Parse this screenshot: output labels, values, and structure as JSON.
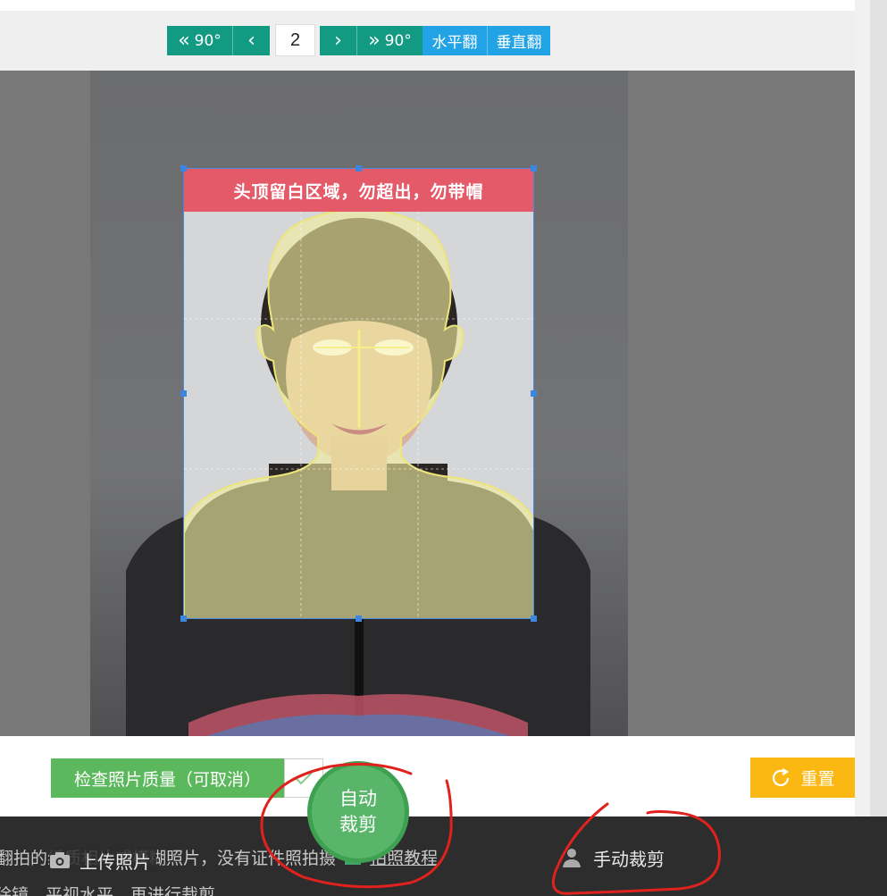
{
  "toolbar": {
    "rotate_left_label": "90°",
    "rotate_right_label": "90°",
    "page_number": "2",
    "flip_horizontal_label": "水平翻",
    "flip_vertical_label": "垂直翻"
  },
  "crop": {
    "banner_text": "头顶留白区域，勿超出，勿带帽"
  },
  "quality_check": {
    "label": "检查照片质量（可取消）",
    "checked": true
  },
  "reset_label": "重置",
  "auto_crop": {
    "line1": "自动",
    "line2": "裁剪"
  },
  "bottom_bar": {
    "text_line1_start": "翻拍的纸质相片",
    "text_line1_mid": "或模糊照片，没有证件照",
    "text_line1_end": "拍摄",
    "tutorial_link": "拍照教程",
    "text_line2": "除镜，平视水平，再进行裁剪。",
    "upload_label": "上传照片",
    "manual_crop_label": "手动裁剪"
  },
  "colors": {
    "teal": "#129a82",
    "blue": "#21a3e5",
    "green": "#5cb85c",
    "orange": "#fbb812",
    "banner_red": "#e55a69",
    "annotation_red": "#e0221e"
  }
}
